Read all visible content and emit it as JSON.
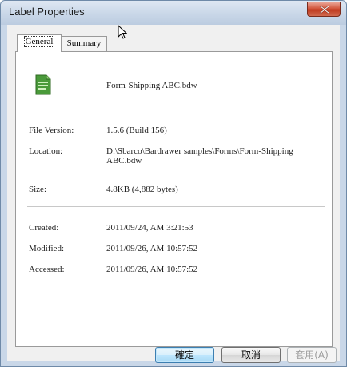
{
  "window": {
    "title": "Label Properties"
  },
  "tabs": [
    {
      "label": "General",
      "active": true
    },
    {
      "label": "Summary",
      "active": false
    }
  ],
  "file": {
    "icon": "bartender-document-icon",
    "name": "Form-Shipping ABC.bdw"
  },
  "details": {
    "version_label": "File Version:",
    "version_value": "1.5.6 (Build 156)",
    "location_label": "Location:",
    "location_line1": "D:\\Sbarco\\Bardrawer samples\\Forms\\Form-Shipping",
    "location_line2": "ABC.bdw",
    "size_label": "Size:",
    "size_value": "4.8KB (4,882 bytes)"
  },
  "dates": {
    "created_label": "Created:",
    "created_value": "2011/09/24, AM 3:21:53",
    "modified_label": "Modified:",
    "modified_value": "2011/09/26, AM 10:57:52",
    "accessed_label": "Accessed:",
    "accessed_value": "2011/09/26, AM 10:57:52"
  },
  "buttons": {
    "ok": "確定",
    "cancel": "取消",
    "apply": "套用(A)"
  },
  "colors": {
    "title_bar": "#c9d7e8",
    "close_button": "#c8452a",
    "ok_border": "#3c7fb1"
  }
}
